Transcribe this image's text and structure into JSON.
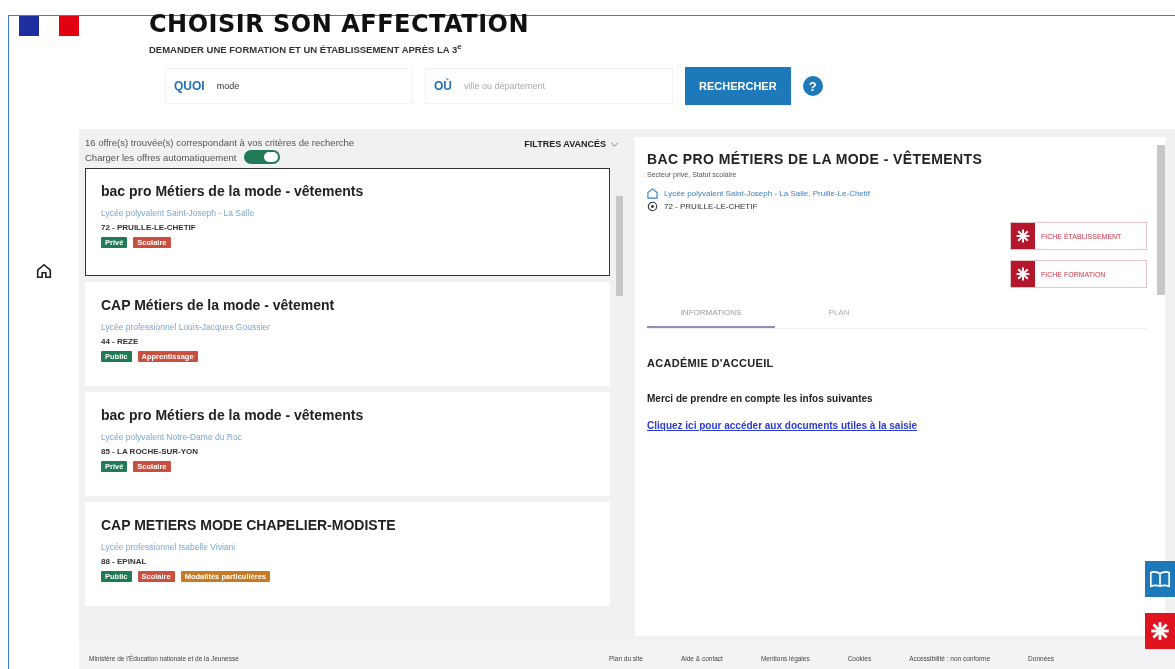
{
  "header": {
    "title": "CHOISIR SON AFFECTATION",
    "subtitle": "DEMANDER UNE FORMATION ET UN ÉTABLISSEMENT APRÈS LA 3$^{e}$"
  },
  "search": {
    "what_label": "QUOI",
    "what_value": "mode",
    "where_label": "OÙ",
    "where_placeholder": "ville ou département",
    "button": "RECHERCHER",
    "help": "?"
  },
  "results": {
    "count": "16 offre(s) trouvée(s) correspondant à vos critères de recherche",
    "auto_load": {
      "label": "Charger les offres automatiquement",
      "on": true
    },
    "filters": "FILTRES AVANCÉS"
  },
  "offers": [
    {
      "title": "bac pro Métiers de la mode - vêtements",
      "school": "Lycée polyvalent Saint-Joseph - La Salle",
      "place": "72 - PRUILLE-LE-CHETIF",
      "selected": true,
      "tags": [
        {
          "label": "Privé",
          "color": "#1f7a55"
        },
        {
          "label": "Scolaire",
          "color": "#c9503f"
        }
      ]
    },
    {
      "title": "CAP Métiers de la mode - vêtement",
      "school": "Lycée professionnel Louis-Jacques Goussier",
      "place": "44 - REZE",
      "selected": false,
      "tags": [
        {
          "label": "Public",
          "color": "#1f7a55"
        },
        {
          "label": "Apprentissage",
          "color": "#c9503f"
        }
      ]
    },
    {
      "title": "bac pro Métiers de la mode - vêtements",
      "school": "Lycée polyvalent Notre-Dame du Roc",
      "place": "85 - LA ROCHE-SUR-YON",
      "selected": false,
      "tags": [
        {
          "label": "Privé",
          "color": "#1f7a55"
        },
        {
          "label": "Scolaire",
          "color": "#c9503f"
        }
      ]
    },
    {
      "title": "CAP METIERS MODE CHAPELIER-MODISTE",
      "school": "Lycée professionnel Isabelle Viviani",
      "place": "88 - EPINAL",
      "selected": false,
      "tags": [
        {
          "label": "Public",
          "color": "#1f7a55"
        },
        {
          "label": "Scolaire",
          "color": "#c9503f"
        },
        {
          "label": "Modalités particulières",
          "color": "#c77a24"
        }
      ]
    }
  ],
  "detail": {
    "title": "BAC PRO MÉTIERS DE LA MODE - VÊTEMENTS",
    "subtitle": "Secteur privé, Statut scolaire",
    "school": "Lycée polyvalent Saint-Joseph - La Salle, Pruille-Le-Chetif",
    "place": "72 - PRUILLE-LE-CHETIF",
    "buttons": [
      "FICHE ÉTABLISSEMENT",
      "FICHE FORMATION"
    ],
    "tabs": [
      {
        "label": "INFORMATIONS",
        "selected": true
      },
      {
        "label": "PLAN",
        "selected": false
      }
    ],
    "section_title": "ACADÉMIE D'ACCUEIL",
    "text": "Merci de prendre en compte les infos suivantes",
    "link": "Cliquez ici pour accéder aux documents utiles à la saisie"
  },
  "footer": {
    "note": "Ministère de l'Éducation nationale et de la Jeunesse",
    "links": [
      "Plan du site",
      "Aide & contact",
      "Mentions légales",
      "Cookies",
      "Accessibilité : non conforme",
      "Données"
    ]
  }
}
